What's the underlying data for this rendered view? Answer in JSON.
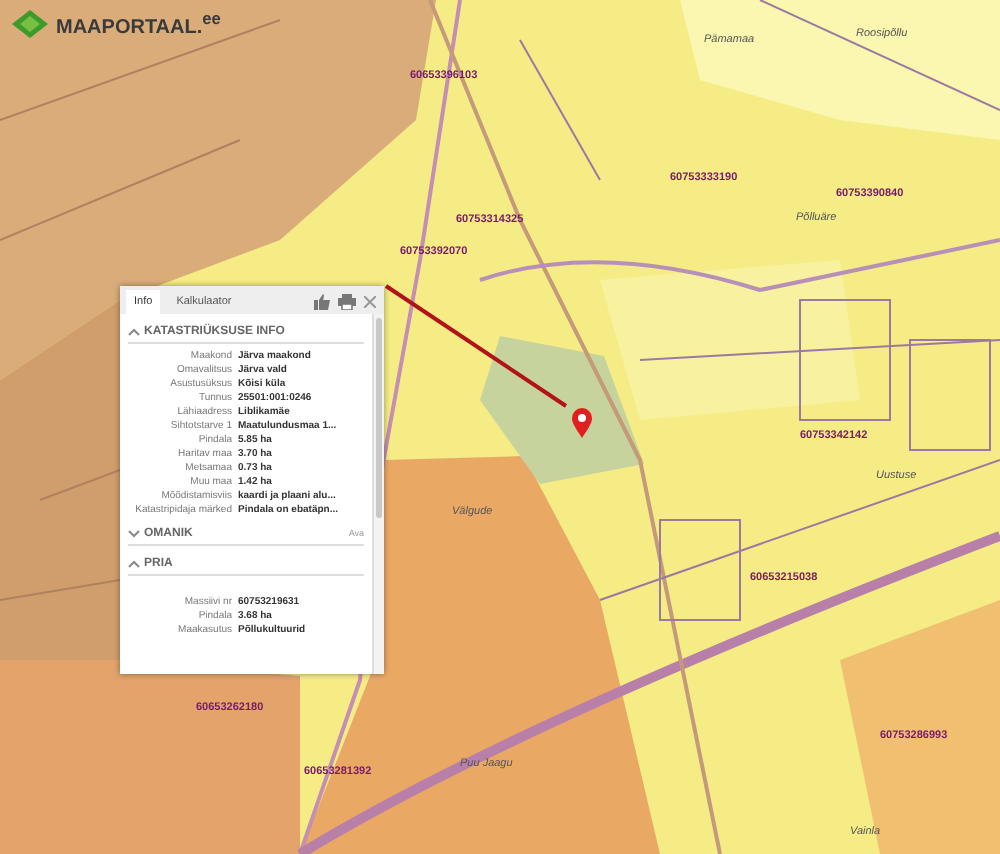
{
  "logo": {
    "text": "MAAPORTAAL.$^{ee}$"
  },
  "map_labels": [
    {
      "text": "60653396103",
      "kind": "parcel"
    },
    {
      "text": "60753314325",
      "kind": "parcel"
    },
    {
      "text": "60753392070",
      "kind": "parcel"
    },
    {
      "text": "60753333190",
      "kind": "parcel"
    },
    {
      "text": "60753390840",
      "kind": "parcel"
    },
    {
      "text": "60753342142",
      "kind": "parcel"
    },
    {
      "text": "60653215038",
      "kind": "parcel"
    },
    {
      "text": "60653262180",
      "kind": "parcel"
    },
    {
      "text": "60653281392",
      "kind": "parcel"
    },
    {
      "text": "60753286993",
      "kind": "parcel"
    },
    {
      "text": "Pämamaa",
      "kind": "place"
    },
    {
      "text": "Roosipõllu",
      "kind": "place"
    },
    {
      "text": "Põlluäre",
      "kind": "place"
    },
    {
      "text": "Välgude",
      "kind": "place"
    },
    {
      "text": "Uustuse",
      "kind": "place"
    },
    {
      "text": "Puu Jaagu",
      "kind": "place"
    },
    {
      "text": "Vainla",
      "kind": "place"
    }
  ],
  "popup": {
    "tabs": [
      {
        "label": "Info",
        "selected": true
      },
      {
        "label": "Kalkulaator",
        "selected": false
      }
    ],
    "sections": [
      {
        "title": "KATASTRIÜKSUSE INFO",
        "expanded": true,
        "rows": [
          {
            "label": "Maakond",
            "value": "Järva maakond"
          },
          {
            "label": "Omavalitsus",
            "value": "Järva vald"
          },
          {
            "label": "Asustusüksus",
            "value": "Kõisi küla"
          },
          {
            "label": "Tunnus",
            "value": "25501:001:0246"
          },
          {
            "label": "Lähiaadress",
            "value": "Liblikamäe"
          },
          {
            "label": "Sihtotstarve 1",
            "value": "Maatulundusmaa 1..."
          },
          {
            "label": "Pindala",
            "value": "5.85 ha"
          },
          {
            "label": "Haritav maa",
            "value": "3.70 ha"
          },
          {
            "label": "Metsamaa",
            "value": "0.73 ha"
          },
          {
            "label": "Muu maa",
            "value": "1.42 ha"
          },
          {
            "label": "Mõõdistamisviis",
            "value": "kaardi ja plaani alu..."
          },
          {
            "label": "Katastripidaja märked",
            "value": "Pindala on ebatäpn..."
          }
        ]
      },
      {
        "title": "OMANIK",
        "expanded": false,
        "action": "Ava"
      },
      {
        "title": "PRIA",
        "expanded": true,
        "rows": [
          {
            "label": "Massiivi nr",
            "value": "60753219631"
          },
          {
            "label": "Pindala",
            "value": "3.68 ha"
          },
          {
            "label": "Maakasutus",
            "value": "Põllukultuurid"
          }
        ]
      }
    ]
  }
}
